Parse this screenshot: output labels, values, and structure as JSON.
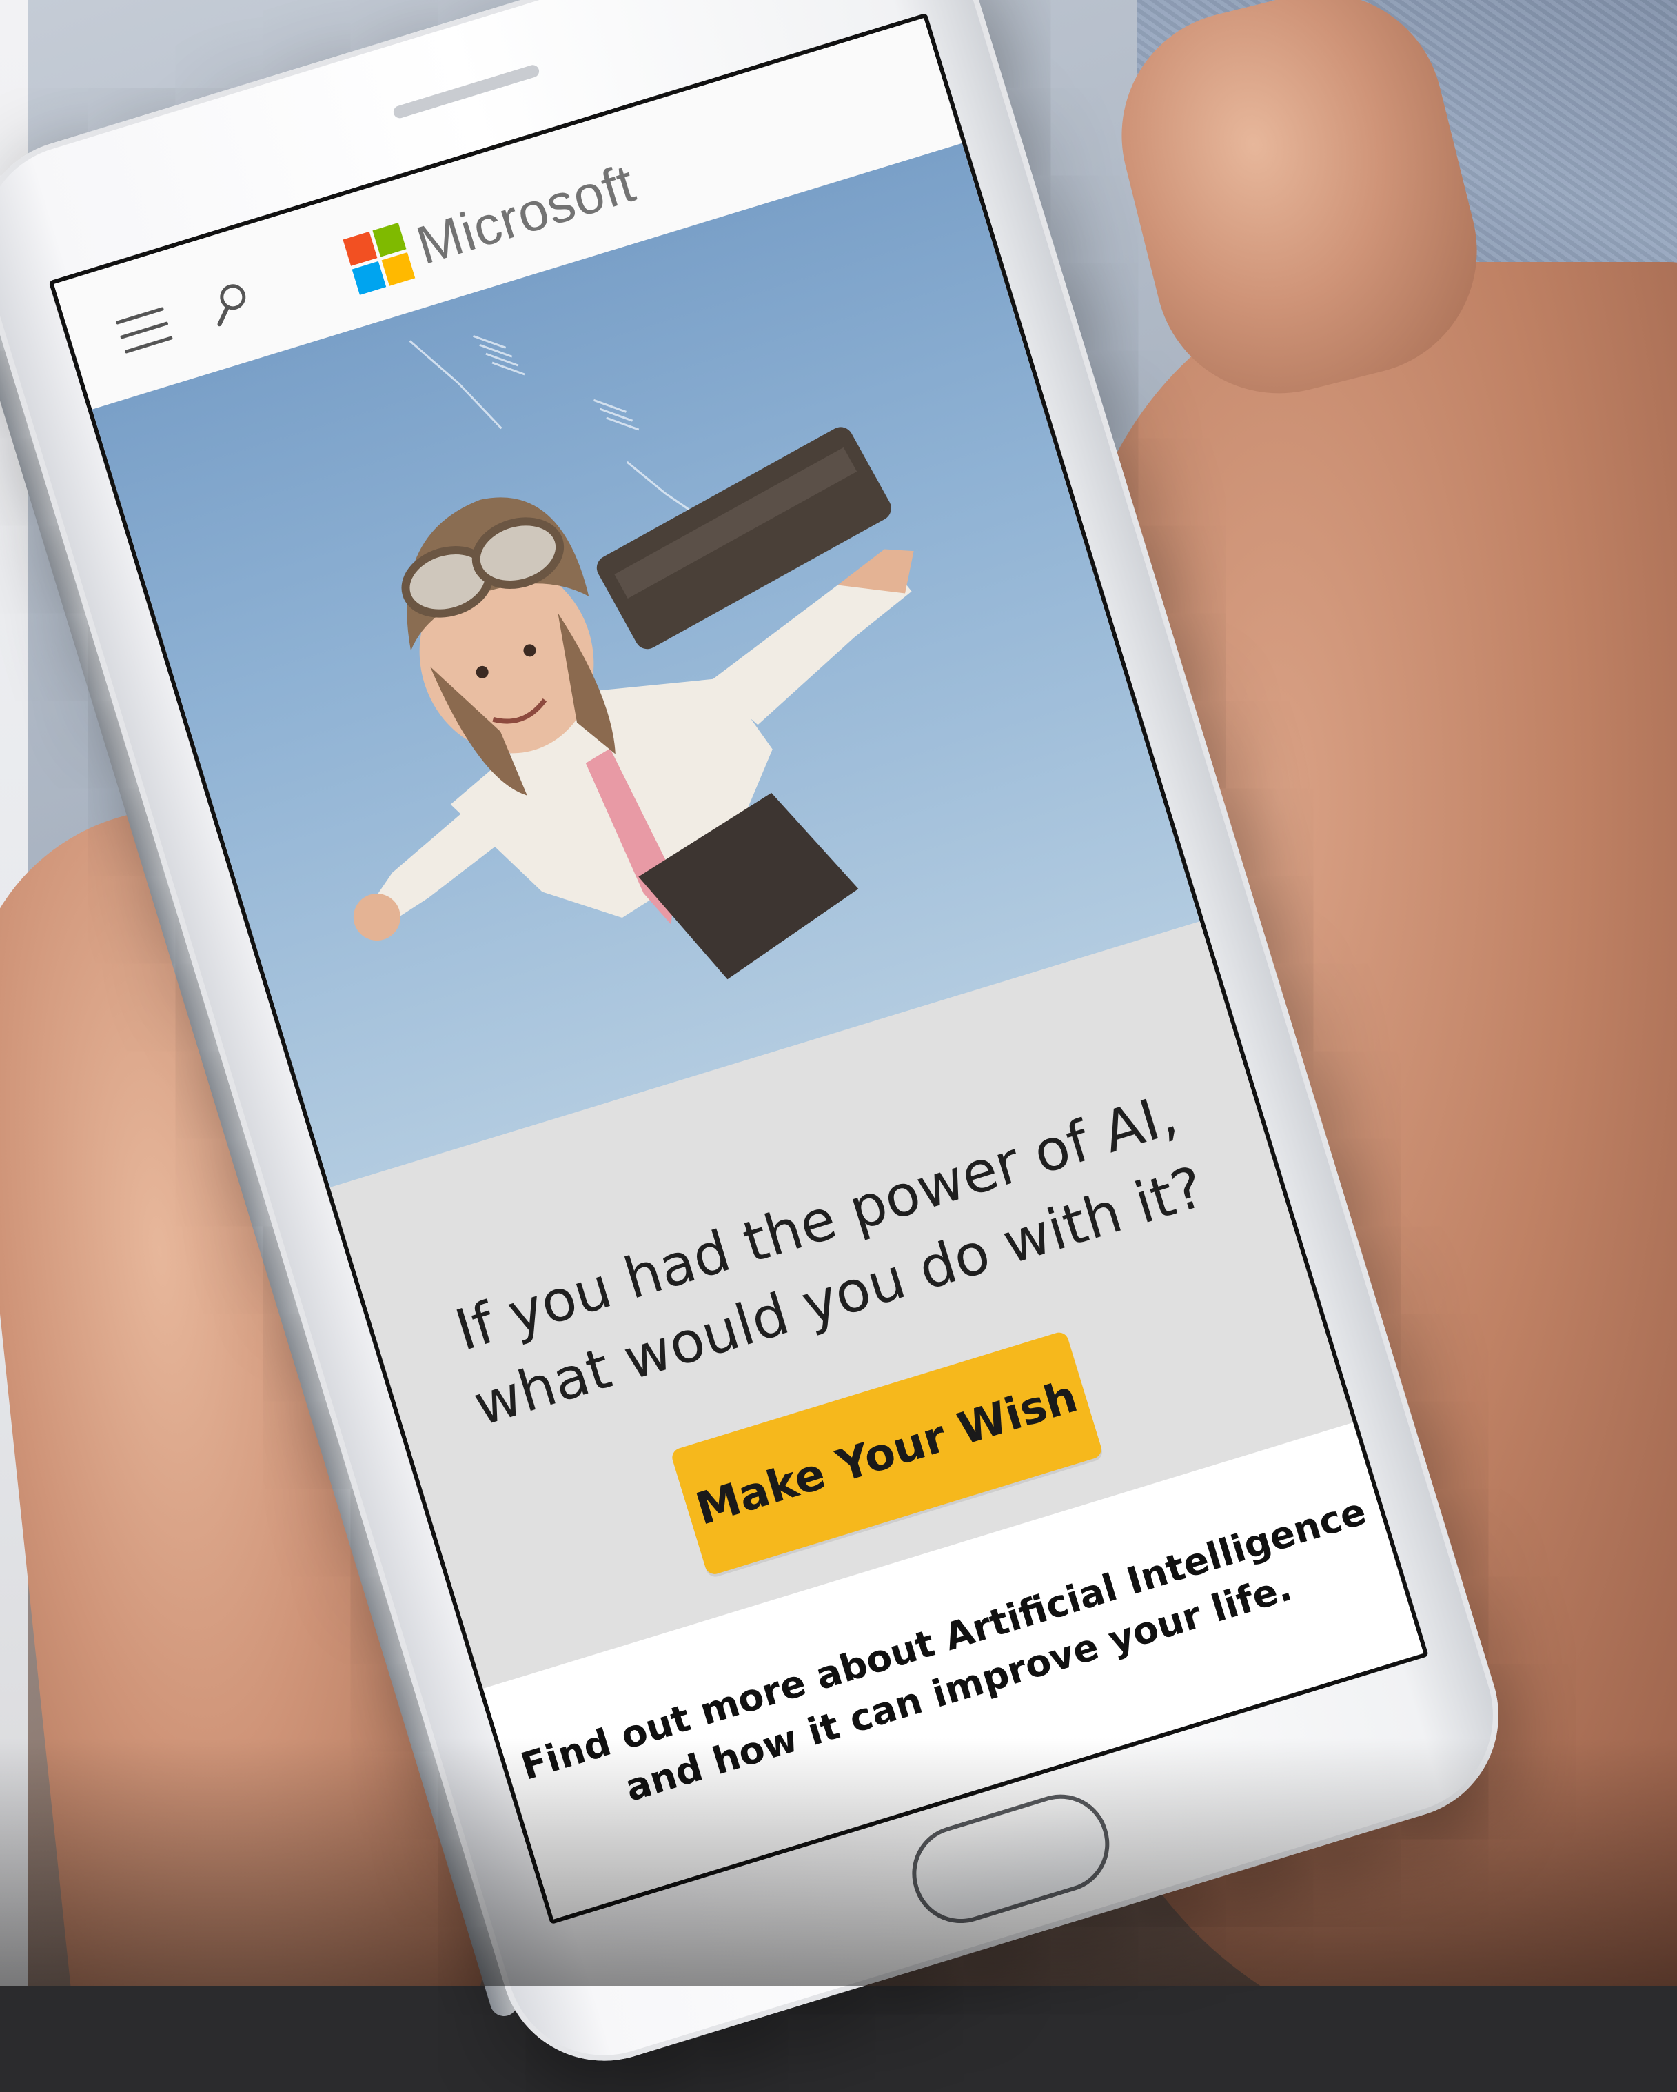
{
  "header": {
    "brand_name": "Microsoft",
    "menu_icon": "hamburger-menu-icon",
    "search_icon": "search-icon"
  },
  "brand_colors": {
    "logo_red": "#f25022",
    "logo_green": "#7fba00",
    "logo_blue": "#00a4ef",
    "logo_yellow": "#ffb900"
  },
  "hero": {
    "image": "child-aviator-flying-with-jetpack-illustration"
  },
  "main": {
    "headline_line1": "If you had the power of AI,",
    "headline_line2": "what would you do with it?",
    "cta_label": "Make Your Wish",
    "cta_color": "#f6b81c"
  },
  "footer": {
    "line1": "Find out more about Artificial Intelligence",
    "line2": "and how it can improve your life."
  },
  "device": {
    "home_button_icon": "home-button"
  }
}
